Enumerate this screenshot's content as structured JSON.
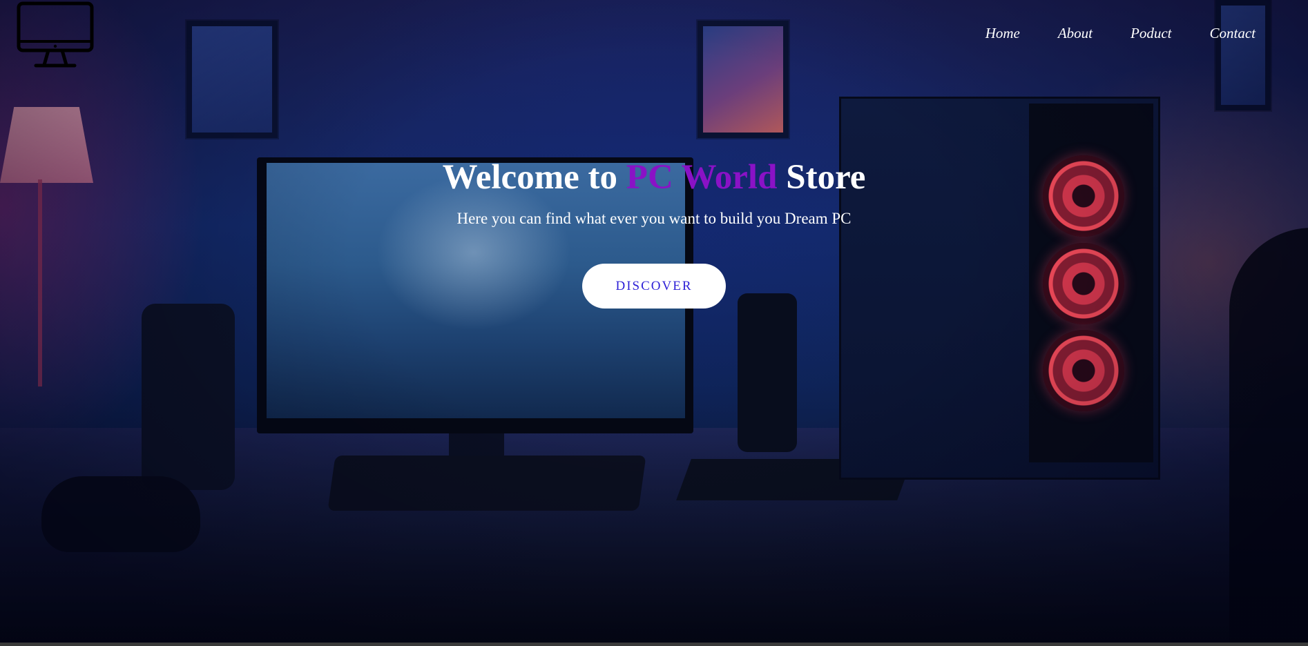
{
  "header": {
    "logo_icon": "desktop-monitor-icon",
    "nav": [
      {
        "label": "Home"
      },
      {
        "label": "About"
      },
      {
        "label": "Poduct"
      },
      {
        "label": "Contact"
      }
    ]
  },
  "hero": {
    "headline_prefix": "Welcome to ",
    "headline_brand": "PC World",
    "headline_suffix": " Store",
    "subtitle": "Here you can find what ever you want to build you Dream PC",
    "cta_label": "DISCOVER"
  },
  "colors": {
    "brand_purple": "#8a12c6",
    "cta_text": "#2c1fd6",
    "nav_text": "#ffffff"
  }
}
